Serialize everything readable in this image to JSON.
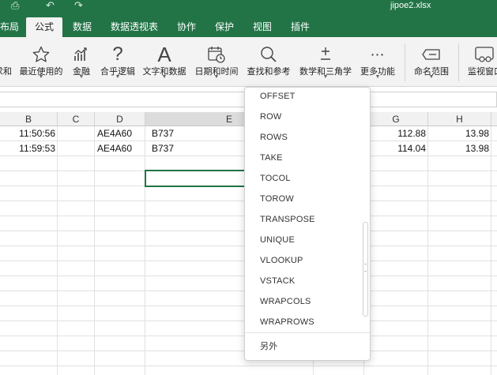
{
  "window": {
    "filename": "jipoe2.xlsx"
  },
  "tabs": [
    {
      "label": "布局"
    },
    {
      "label": "公式"
    },
    {
      "label": "数据"
    },
    {
      "label": "数据透视表"
    },
    {
      "label": "协作"
    },
    {
      "label": "保护"
    },
    {
      "label": "视图"
    },
    {
      "label": "插件"
    }
  ],
  "ribbon": {
    "buttons": [
      {
        "label": "求和",
        "icon": "sum-icon"
      },
      {
        "label": "最近使用的",
        "icon": "star-icon"
      },
      {
        "label": "金融",
        "icon": "finance-chart-icon"
      },
      {
        "label": "合乎逻辑",
        "icon": "question-icon"
      },
      {
        "label": "文字和数据",
        "icon": "text-a-icon"
      },
      {
        "label": "日期和时间",
        "icon": "calendar-clock-icon"
      },
      {
        "label": "查找和参考",
        "icon": "magnifier-icon"
      },
      {
        "label": "数学和三角学",
        "icon": "plus-minus-icon"
      },
      {
        "label": "更多功能",
        "icon": "more-dots-icon"
      },
      {
        "label": "命名范围",
        "icon": "name-tag-icon"
      },
      {
        "label": "监视窗口",
        "icon": "watch-window-icon"
      }
    ]
  },
  "grid": {
    "columns": [
      {
        "label": "B"
      },
      {
        "label": "C"
      },
      {
        "label": "D"
      },
      {
        "label": "E"
      },
      {
        "label": "G"
      },
      {
        "label": "H"
      }
    ],
    "rows": [
      {
        "b": "11:50:56",
        "d": "AE4A60",
        "e": "B737",
        "g": "112.88",
        "h": "13.98"
      },
      {
        "b": "11:59:53",
        "d": "AE4A60",
        "e": "B737",
        "g": "114.04",
        "h": "13.98"
      }
    ]
  },
  "function_menu": {
    "items": [
      {
        "label": "OFFSET"
      },
      {
        "label": "ROW"
      },
      {
        "label": "ROWS"
      },
      {
        "label": "TAKE"
      },
      {
        "label": "TOCOL"
      },
      {
        "label": "TOROW"
      },
      {
        "label": "TRANSPOSE"
      },
      {
        "label": "UNIQUE"
      },
      {
        "label": "VLOOKUP"
      },
      {
        "label": "VSTACK"
      },
      {
        "label": "WRAPCOLS"
      },
      {
        "label": "WRAPROWS"
      }
    ],
    "footer": {
      "label": "另外"
    }
  },
  "colors": {
    "header_green": "#227447",
    "ribbon_bg": "#f3f3f3",
    "active_cell_border": "#217346"
  }
}
